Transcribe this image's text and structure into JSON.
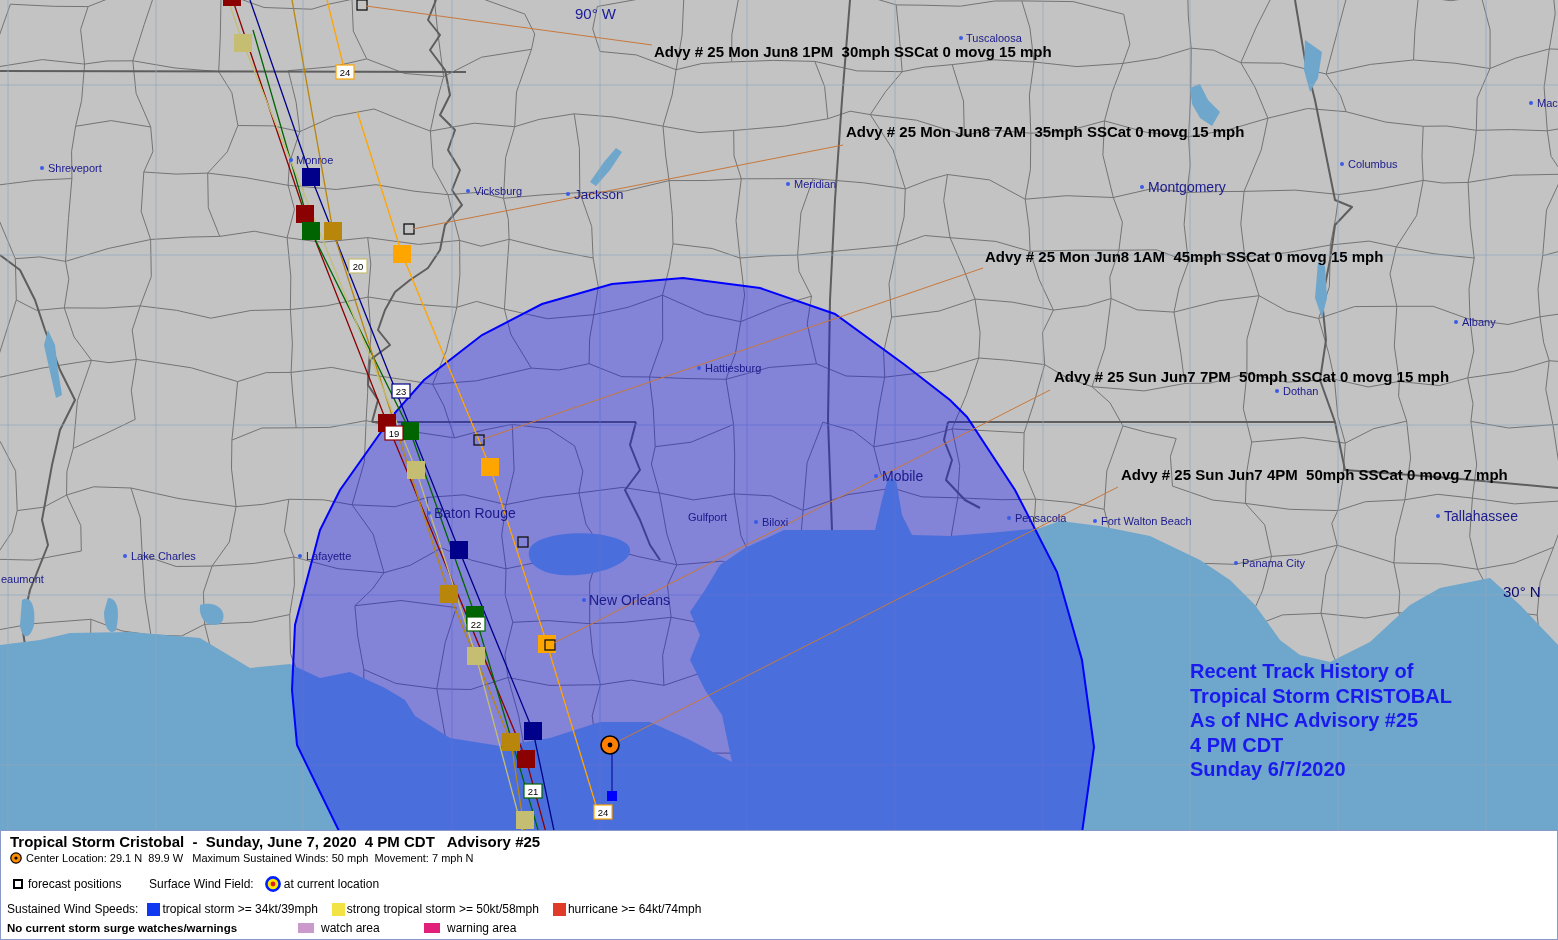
{
  "map": {
    "grid_labels": [
      "90° W",
      "30° N"
    ],
    "tracks": [
      {
        "color": "#8b0000"
      },
      {
        "color": "#006400"
      },
      {
        "color": "#00008b"
      },
      {
        "color": "#b8860b"
      },
      {
        "color": "#c4bd72"
      },
      {
        "color": "#ffa500"
      }
    ],
    "track_numbers": [
      "24",
      "20",
      "23",
      "19",
      "22",
      "21",
      "24"
    ],
    "cities": [
      "Tuscaloosa",
      "Shreveport",
      "Monroe",
      "Vicksburg",
      "Jackson",
      "Meridian",
      "Montgomery",
      "Columbus",
      "Mac",
      "Albany",
      "Hattiesburg",
      "Dothan",
      "Mobile",
      "Baton Rouge",
      "Gulfport",
      "Biloxi",
      "Pensacola",
      "Fort Walton Beach",
      "Tallahassee",
      "Lake Charles",
      "Lafayette",
      "eaumont",
      "Panama City",
      "New Orleans"
    ],
    "advisories": [
      "Advy # 25 Mon Jun8 1PM  30mph SSCat 0 movg 15 mph",
      "Advy # 25 Mon Jun8 7AM  35mph SSCat 0 movg 15 mph",
      "Advy # 25 Mon Jun8 1AM  45mph SSCat 0 movg 15 mph",
      "Advy # 25 Sun Jun7 7PM  50mph SSCat 0 movg 15 mph",
      "Advy # 25 Sun Jun7 4PM  50mph SSCat 0 movg 7 mph"
    ],
    "caption": [
      "Recent Track History of",
      "Tropical Storm CRISTOBAL",
      "As of NHC Advisory #25",
      "4 PM CDT",
      "Sunday 6/7/2020"
    ]
  },
  "legend": {
    "title": "Tropical Storm Cristobal  -  Sunday, June 7, 2020  4 PM CDT   Advisory #25",
    "details": "Center Location: 29.1 N  89.9 W   Maximum Sustained Winds: 50 mph  Movement: 7 mph N",
    "forecast_label": "forecast positions",
    "wind_field_label": "Surface Wind Field:",
    "wind_field_note": "at current location",
    "wind_speeds_label": "Sustained Wind Speeds:",
    "wind_speeds": [
      {
        "label": "tropical storm >= 34kt/39mph",
        "color": "#1038f0"
      },
      {
        "label": "strong tropical storm >= 50kt/58mph",
        "color": "#f2e244"
      },
      {
        "label": "hurricane >= 64kt/74mph",
        "color": "#e03a28"
      }
    ],
    "surge_note": "No current storm surge watches/warnings",
    "surge_areas": [
      {
        "label": "watch area",
        "color": "#cc99cc"
      },
      {
        "label": "warning area",
        "color": "#e0207a"
      }
    ]
  }
}
